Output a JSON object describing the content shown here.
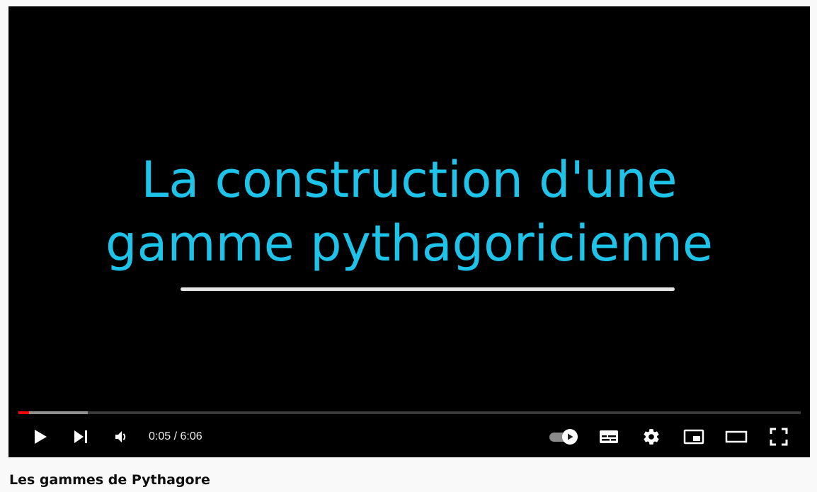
{
  "player": {
    "slide": {
      "line1": "La construction d'une",
      "line2": "gamme pythagoricienne"
    },
    "progress": {
      "played_fraction": 0.0137,
      "buffered_fraction": 0.0885
    },
    "time": {
      "current": "0:05",
      "separator": " / ",
      "duration": "6:06"
    },
    "controls": {
      "play": "play-icon",
      "next": "skip-next-icon",
      "volume": "volume-icon",
      "autoplay": "autoplay-toggle",
      "subtitles": "subtitles-icon",
      "settings": "gear-icon",
      "miniplayer": "miniplayer-icon",
      "theater": "theater-mode-icon",
      "fullscreen": "fullscreen-icon"
    },
    "colors": {
      "slide_text": "#1ec3ea",
      "progress_played": "#ff0000"
    }
  },
  "video": {
    "title": "Les gammes de Pythagore"
  }
}
